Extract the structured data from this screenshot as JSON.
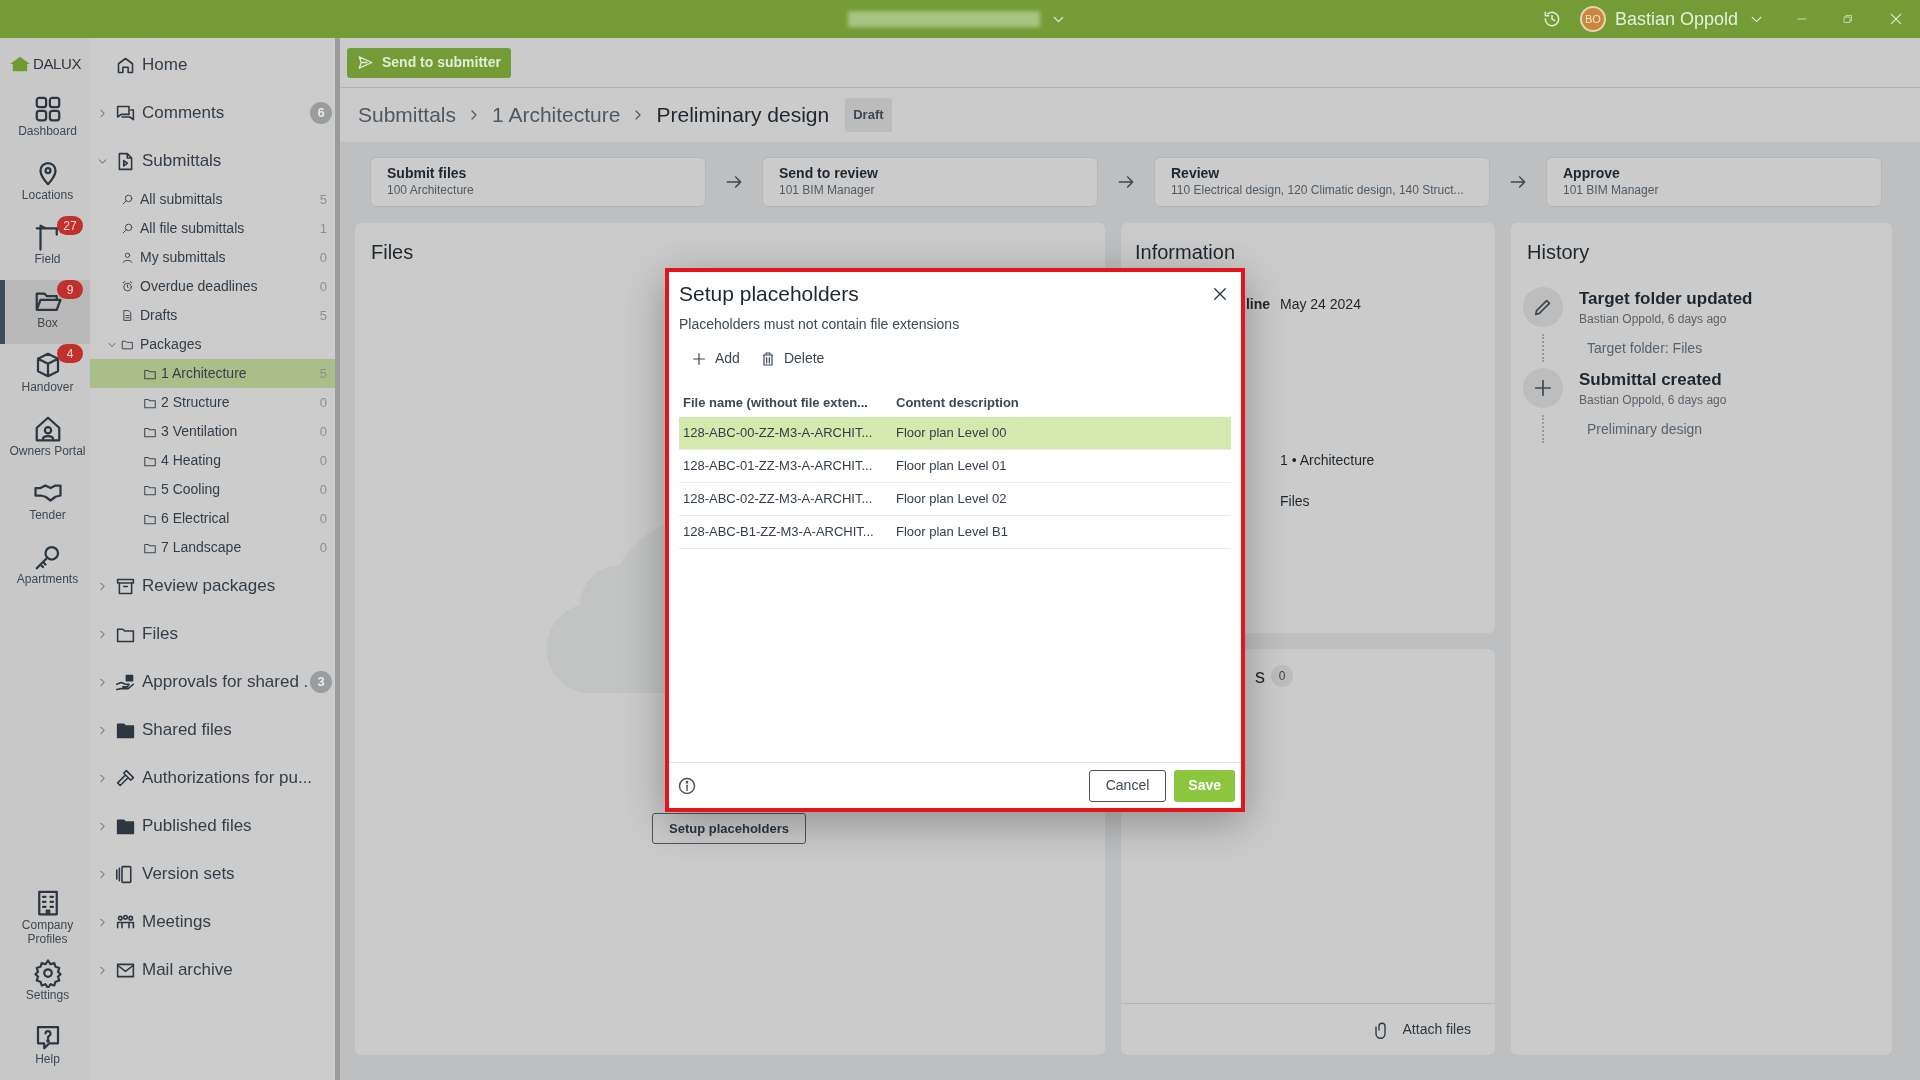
{
  "top_bar": {
    "user_initials": "BO",
    "user_name": "Bastian Oppold"
  },
  "rail": {
    "logo": "DALUX",
    "items": [
      {
        "label": "Dashboard",
        "selected": false
      },
      {
        "label": "Locations",
        "selected": false
      },
      {
        "label": "Field",
        "selected": false,
        "badge": "27"
      },
      {
        "label": "Box",
        "selected": true,
        "badge": "9"
      },
      {
        "label": "Handover",
        "selected": false,
        "badge": "4"
      },
      {
        "label": "Owners Portal",
        "selected": false
      },
      {
        "label": "Tender",
        "selected": false
      },
      {
        "label": "Apartments",
        "selected": false
      }
    ],
    "bottom_items": [
      {
        "label": "Company Profiles",
        "selected": false
      },
      {
        "label": "Settings",
        "selected": false
      },
      {
        "label": "Help",
        "selected": false
      }
    ]
  },
  "sidebar": {
    "items": [
      {
        "label": "Home",
        "selected": false
      },
      {
        "label": "Comments",
        "selected": false,
        "expanded": false,
        "badge": "6"
      },
      {
        "label": "Submittals",
        "selected": false,
        "expanded": true,
        "children": [
          {
            "label": "All submittals",
            "selected": false,
            "count": "5"
          },
          {
            "label": "All file submittals",
            "selected": false,
            "count": "1"
          },
          {
            "label": "My submittals",
            "selected": false,
            "count": "0"
          },
          {
            "label": "Overdue deadlines",
            "selected": false,
            "count": "0"
          },
          {
            "label": "Drafts",
            "selected": false,
            "count": "5"
          },
          {
            "label": "Packages",
            "selected": false,
            "expanded": true,
            "children": [
              {
                "label": "1 Architecture",
                "selected": true,
                "count": "5"
              },
              {
                "label": "2 Structure",
                "selected": false,
                "count": "0"
              },
              {
                "label": "3 Ventilation",
                "selected": false,
                "count": "0"
              },
              {
                "label": "4 Heating",
                "selected": false,
                "count": "0"
              },
              {
                "label": "5 Cooling",
                "selected": false,
                "count": "0"
              },
              {
                "label": "6 Electrical",
                "selected": false,
                "count": "0"
              },
              {
                "label": "7 Landscape",
                "selected": false,
                "count": "0"
              }
            ]
          }
        ]
      },
      {
        "label": "Review packages",
        "selected": false,
        "expanded": false
      },
      {
        "label": "Files",
        "selected": false,
        "expanded": false
      },
      {
        "label": "Approvals for shared .",
        "selected": false,
        "expanded": false,
        "badge": "3"
      },
      {
        "label": "Shared files",
        "selected": false,
        "expanded": false
      },
      {
        "label": "Authorizations for pu...",
        "selected": false,
        "expanded": false
      },
      {
        "label": "Published files",
        "selected": false,
        "expanded": false
      },
      {
        "label": "Version sets",
        "selected": false,
        "expanded": false
      },
      {
        "label": "Meetings",
        "selected": false,
        "expanded": false
      },
      {
        "label": "Mail archive",
        "selected": false,
        "expanded": false
      }
    ]
  },
  "toolbar": {
    "primary_button": "Send to submitter"
  },
  "breadcrumb": {
    "items": [
      "Submittals",
      "1 Architecture",
      "Preliminary design"
    ],
    "status_badge": "Draft"
  },
  "steps": [
    {
      "title": "Submit files",
      "subtitle": "100 Architecture"
    },
    {
      "title": "Send to review",
      "subtitle": "101 BIM Manager"
    },
    {
      "title": "Review",
      "subtitle": "110 Electrical design, 120 Climatic design, 140 Struct..."
    },
    {
      "title": "Approve",
      "subtitle": "101 BIM Manager"
    }
  ],
  "files_panel": {
    "title": "Files",
    "button": "Setup placeholders"
  },
  "information": {
    "title": "Information",
    "rows": [
      {
        "label": "line",
        "value": "May 24 2024"
      },
      {
        "value": "1 • Architecture"
      },
      {
        "value": "Files"
      }
    ]
  },
  "attachments_panel": {
    "title_fragment": "s",
    "count": "0",
    "attach_button": "Attach files"
  },
  "history": {
    "title": "History",
    "events": [
      {
        "kind": "edit",
        "title": "Target folder updated",
        "meta": "Bastian Oppold, 6 days ago",
        "detail": "Target folder: Files"
      },
      {
        "kind": "create",
        "title": "Submittal created",
        "meta": "Bastian Oppold, 6 days ago",
        "detail": "Preliminary design"
      }
    ]
  },
  "dialog": {
    "title": "Setup placeholders",
    "hint": "Placeholders must not contain file extensions",
    "actions": [
      "Add",
      "Delete"
    ],
    "columns": [
      "File name (without file exten...",
      "Content description"
    ],
    "rows": [
      {
        "file_name": "128-ABC-00-ZZ-M3-A-ARCHIT...",
        "description": "Floor plan Level 00",
        "selected": true
      },
      {
        "file_name": "128-ABC-01-ZZ-M3-A-ARCHIT...",
        "description": "Floor plan Level 01",
        "selected": false
      },
      {
        "file_name": "128-ABC-02-ZZ-M3-A-ARCHIT...",
        "description": "Floor plan Level 02",
        "selected": false
      },
      {
        "file_name": "128-ABC-B1-ZZ-M3-A-ARCHIT...",
        "description": "Floor plan Level B1",
        "selected": false
      }
    ],
    "cancel": "Cancel",
    "save": "Save"
  }
}
